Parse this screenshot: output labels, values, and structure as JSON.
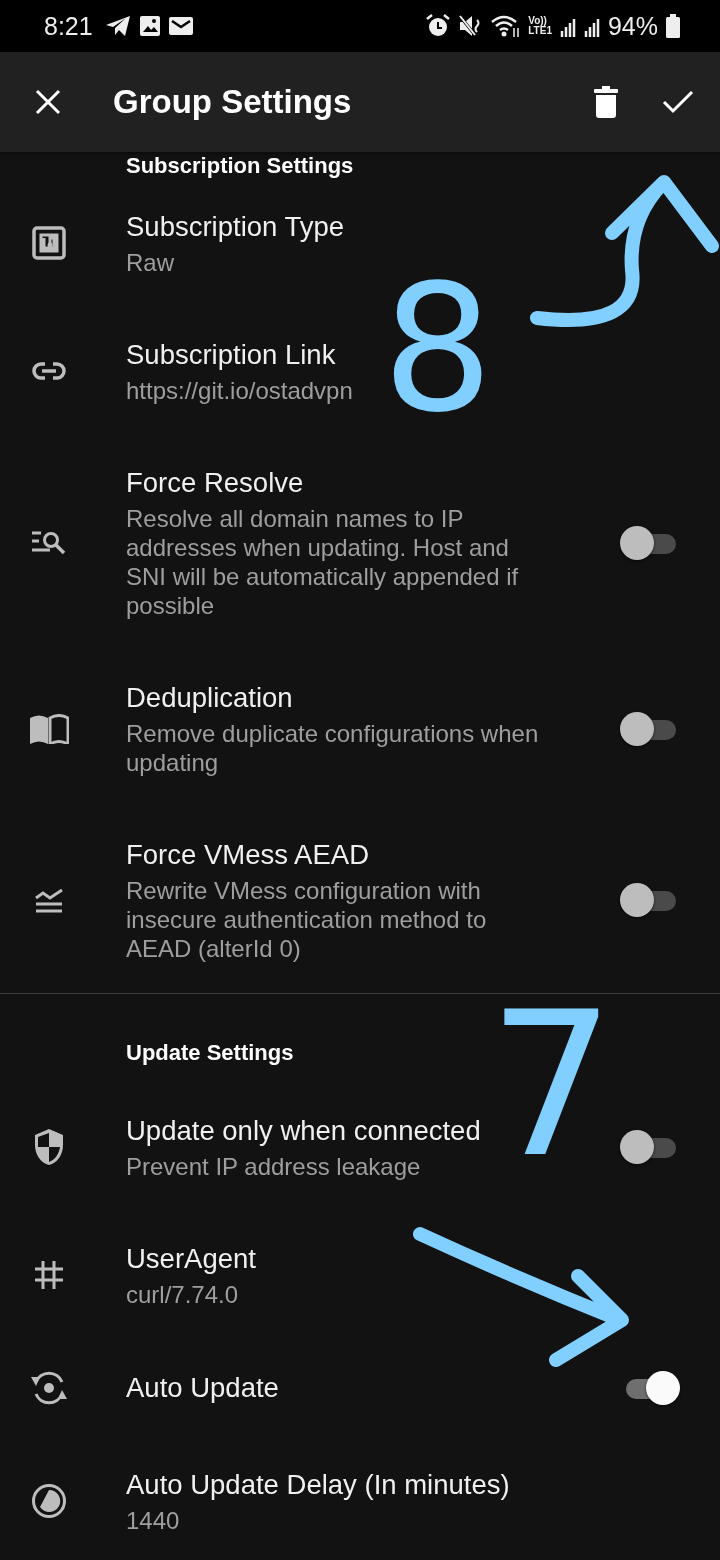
{
  "status_bar": {
    "time": "8:21",
    "network_top": "Vo))",
    "network_bottom": "LTE1",
    "battery": "94%"
  },
  "app_bar": {
    "title": "Group Settings"
  },
  "sections": [
    {
      "header": "Subscription Settings",
      "items": [
        {
          "kind": "text",
          "title": "Subscription Type",
          "subtitle": "Raw"
        },
        {
          "kind": "text",
          "title": "Subscription Link",
          "subtitle": "https://git.io/ostadvpn"
        },
        {
          "kind": "switch",
          "title": "Force Resolve",
          "subtitle": "Resolve all domain names to IP addresses when updating. Host and SNI will be automatically appended if possible",
          "on": false
        },
        {
          "kind": "switch",
          "title": "Deduplication",
          "subtitle": "Remove duplicate configurations when updating",
          "on": false
        },
        {
          "kind": "switch",
          "title": "Force VMess AEAD",
          "subtitle": "Rewrite VMess configuration with insecure authentication method to AEAD (alterId 0)",
          "on": false
        }
      ]
    },
    {
      "header": "Update Settings",
      "items": [
        {
          "kind": "switch",
          "title": "Update only when connected",
          "subtitle": "Prevent IP address leakage",
          "on": false
        },
        {
          "kind": "text",
          "title": "UserAgent",
          "subtitle": "curl/7.74.0"
        },
        {
          "kind": "switch",
          "title": "Auto Update",
          "on": true
        },
        {
          "kind": "text",
          "title": "Auto Update Delay (In minutes)",
          "subtitle": "1440"
        }
      ]
    }
  ],
  "annotations": [
    {
      "text": "8"
    },
    {
      "text": "7"
    }
  ]
}
